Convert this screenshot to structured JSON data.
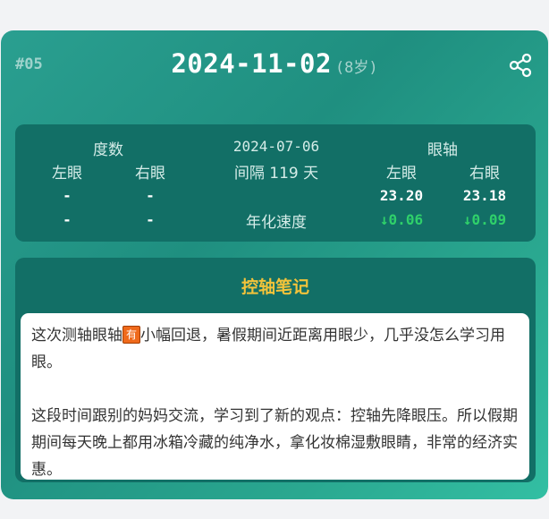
{
  "header": {
    "index": "#05",
    "date": "2024-11-02",
    "age": "(8岁)"
  },
  "icons": {
    "share": "share-icon"
  },
  "stats": {
    "degree_label": "度数",
    "prev_date": "2024-07-06",
    "axis_label": "眼轴",
    "left_eye": "左眼",
    "right_eye": "右眼",
    "interval": "间隔 119 天",
    "annual_speed": "年化速度",
    "degree_left": [
      "-",
      "-"
    ],
    "degree_right": [
      "-",
      "-"
    ],
    "axis_left_value": "23.20",
    "axis_right_value": "23.18",
    "axis_left_change": "↓0.06",
    "axis_right_change": "↓0.09"
  },
  "notes": {
    "title": "控轴笔记",
    "para1_before": "这次测轴眼轴",
    "badge": "有",
    "para1_after": "小幅回退，暑假期间近距离用眼少，几乎没怎么学习用眼。",
    "para2": "这段时间跟别的妈妈交流，学习到了新的观点：控轴先降眼压。所以假期期间每天晚上都用冰箱冷藏的纯净水，拿化妆棉湿敷眼睛，非常的经济实惠。"
  },
  "colors": {
    "card": "#1f8f80",
    "panel": "#126f66",
    "title_accent": "#f3c33a",
    "decrease": "#2fd06a",
    "badge": "#ef6a1b"
  }
}
